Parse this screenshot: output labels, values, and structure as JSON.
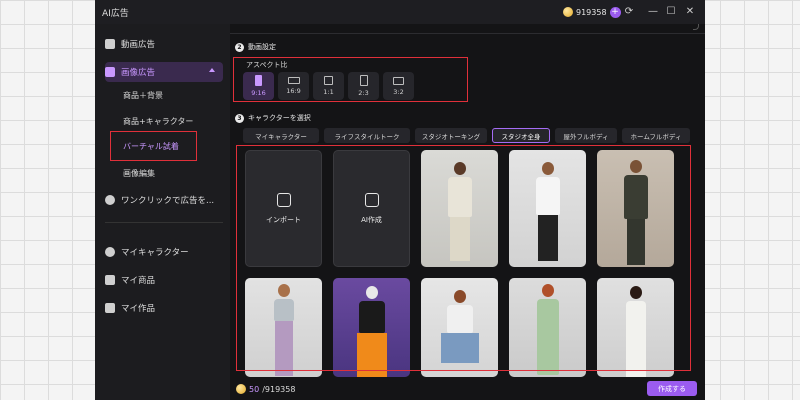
{
  "window": {
    "title": "AI広告",
    "credits": "919358"
  },
  "sidebar": {
    "items": [
      {
        "label": "動画広告",
        "icon": "video-icon"
      },
      {
        "label": "画像広告",
        "icon": "image-icon"
      },
      {
        "label": "ワンクリックで広告を...",
        "icon": "plus-circle-icon"
      }
    ],
    "sub_items": [
      "商品＋背景",
      "商品+キャラクター",
      "バーチャル試着",
      "画像編集"
    ],
    "bottom_items": [
      {
        "label": "マイキャラクター",
        "icon": "people-icon"
      },
      {
        "label": "マイ商品",
        "icon": "box-plus-icon"
      },
      {
        "label": "マイ作品",
        "icon": "folder-icon"
      }
    ]
  },
  "main": {
    "video_settings": {
      "step": "2",
      "title": "動画設定"
    },
    "aspect": {
      "label": "アスペクト比",
      "options": [
        "9:16",
        "16:9",
        "1:1",
        "2:3",
        "3:2"
      ],
      "selected": "9:16"
    },
    "character": {
      "step": "3",
      "title": "キャラクターを選択",
      "tabs": [
        "マイキャラクター",
        "ライフスタイルトーク",
        "スタジオトーキング",
        "スタジオ全身",
        "屋外フルボディ",
        "ホームフルボディ"
      ],
      "selected_tab": "スタジオ全身",
      "actions": [
        {
          "label": "インポート",
          "icon": "import-person-icon"
        },
        {
          "label": "AI作成",
          "icon": "ai-create-icon"
        }
      ]
    }
  },
  "bottom": {
    "used": "50",
    "total": "/919358",
    "create_label": "作成する"
  },
  "colors": {
    "accent": "#9b5cf0",
    "highlight": "#e0303a",
    "background": "#1c1c1f"
  }
}
